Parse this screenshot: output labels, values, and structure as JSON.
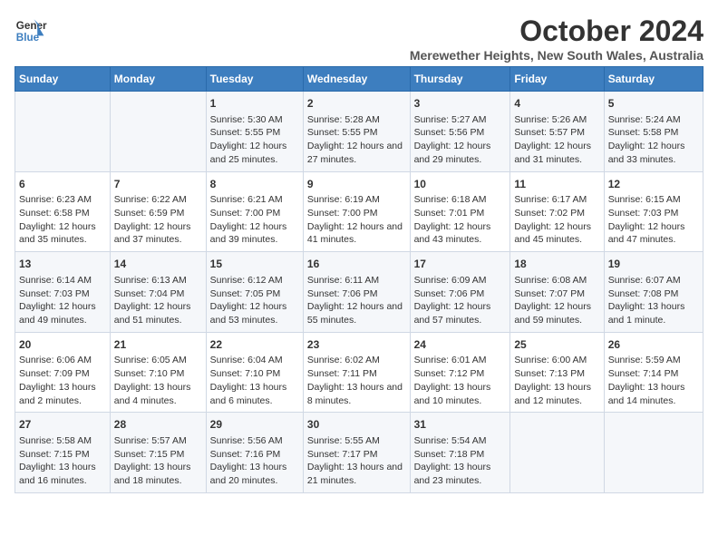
{
  "logo": {
    "line1": "General",
    "line2": "Blue"
  },
  "title": "October 2024",
  "subtitle": "Merewether Heights, New South Wales, Australia",
  "days_of_week": [
    "Sunday",
    "Monday",
    "Tuesday",
    "Wednesday",
    "Thursday",
    "Friday",
    "Saturday"
  ],
  "weeks": [
    [
      {
        "day": "",
        "info": ""
      },
      {
        "day": "",
        "info": ""
      },
      {
        "day": "1",
        "sunrise": "5:30 AM",
        "sunset": "5:55 PM",
        "daylight": "12 hours and 25 minutes."
      },
      {
        "day": "2",
        "sunrise": "5:28 AM",
        "sunset": "5:55 PM",
        "daylight": "12 hours and 27 minutes."
      },
      {
        "day": "3",
        "sunrise": "5:27 AM",
        "sunset": "5:56 PM",
        "daylight": "12 hours and 29 minutes."
      },
      {
        "day": "4",
        "sunrise": "5:26 AM",
        "sunset": "5:57 PM",
        "daylight": "12 hours and 31 minutes."
      },
      {
        "day": "5",
        "sunrise": "5:24 AM",
        "sunset": "5:58 PM",
        "daylight": "12 hours and 33 minutes."
      }
    ],
    [
      {
        "day": "6",
        "sunrise": "6:23 AM",
        "sunset": "6:58 PM",
        "daylight": "12 hours and 35 minutes."
      },
      {
        "day": "7",
        "sunrise": "6:22 AM",
        "sunset": "6:59 PM",
        "daylight": "12 hours and 37 minutes."
      },
      {
        "day": "8",
        "sunrise": "6:21 AM",
        "sunset": "7:00 PM",
        "daylight": "12 hours and 39 minutes."
      },
      {
        "day": "9",
        "sunrise": "6:19 AM",
        "sunset": "7:00 PM",
        "daylight": "12 hours and 41 minutes."
      },
      {
        "day": "10",
        "sunrise": "6:18 AM",
        "sunset": "7:01 PM",
        "daylight": "12 hours and 43 minutes."
      },
      {
        "day": "11",
        "sunrise": "6:17 AM",
        "sunset": "7:02 PM",
        "daylight": "12 hours and 45 minutes."
      },
      {
        "day": "12",
        "sunrise": "6:15 AM",
        "sunset": "7:03 PM",
        "daylight": "12 hours and 47 minutes."
      }
    ],
    [
      {
        "day": "13",
        "sunrise": "6:14 AM",
        "sunset": "7:03 PM",
        "daylight": "12 hours and 49 minutes."
      },
      {
        "day": "14",
        "sunrise": "6:13 AM",
        "sunset": "7:04 PM",
        "daylight": "12 hours and 51 minutes."
      },
      {
        "day": "15",
        "sunrise": "6:12 AM",
        "sunset": "7:05 PM",
        "daylight": "12 hours and 53 minutes."
      },
      {
        "day": "16",
        "sunrise": "6:11 AM",
        "sunset": "7:06 PM",
        "daylight": "12 hours and 55 minutes."
      },
      {
        "day": "17",
        "sunrise": "6:09 AM",
        "sunset": "7:06 PM",
        "daylight": "12 hours and 57 minutes."
      },
      {
        "day": "18",
        "sunrise": "6:08 AM",
        "sunset": "7:07 PM",
        "daylight": "12 hours and 59 minutes."
      },
      {
        "day": "19",
        "sunrise": "6:07 AM",
        "sunset": "7:08 PM",
        "daylight": "13 hours and 1 minute."
      }
    ],
    [
      {
        "day": "20",
        "sunrise": "6:06 AM",
        "sunset": "7:09 PM",
        "daylight": "13 hours and 2 minutes."
      },
      {
        "day": "21",
        "sunrise": "6:05 AM",
        "sunset": "7:10 PM",
        "daylight": "13 hours and 4 minutes."
      },
      {
        "day": "22",
        "sunrise": "6:04 AM",
        "sunset": "7:10 PM",
        "daylight": "13 hours and 6 minutes."
      },
      {
        "day": "23",
        "sunrise": "6:02 AM",
        "sunset": "7:11 PM",
        "daylight": "13 hours and 8 minutes."
      },
      {
        "day": "24",
        "sunrise": "6:01 AM",
        "sunset": "7:12 PM",
        "daylight": "13 hours and 10 minutes."
      },
      {
        "day": "25",
        "sunrise": "6:00 AM",
        "sunset": "7:13 PM",
        "daylight": "13 hours and 12 minutes."
      },
      {
        "day": "26",
        "sunrise": "5:59 AM",
        "sunset": "7:14 PM",
        "daylight": "13 hours and 14 minutes."
      }
    ],
    [
      {
        "day": "27",
        "sunrise": "5:58 AM",
        "sunset": "7:15 PM",
        "daylight": "13 hours and 16 minutes."
      },
      {
        "day": "28",
        "sunrise": "5:57 AM",
        "sunset": "7:15 PM",
        "daylight": "13 hours and 18 minutes."
      },
      {
        "day": "29",
        "sunrise": "5:56 AM",
        "sunset": "7:16 PM",
        "daylight": "13 hours and 20 minutes."
      },
      {
        "day": "30",
        "sunrise": "5:55 AM",
        "sunset": "7:17 PM",
        "daylight": "13 hours and 21 minutes."
      },
      {
        "day": "31",
        "sunrise": "5:54 AM",
        "sunset": "7:18 PM",
        "daylight": "13 hours and 23 minutes."
      },
      {
        "day": "",
        "info": ""
      },
      {
        "day": "",
        "info": ""
      }
    ]
  ]
}
